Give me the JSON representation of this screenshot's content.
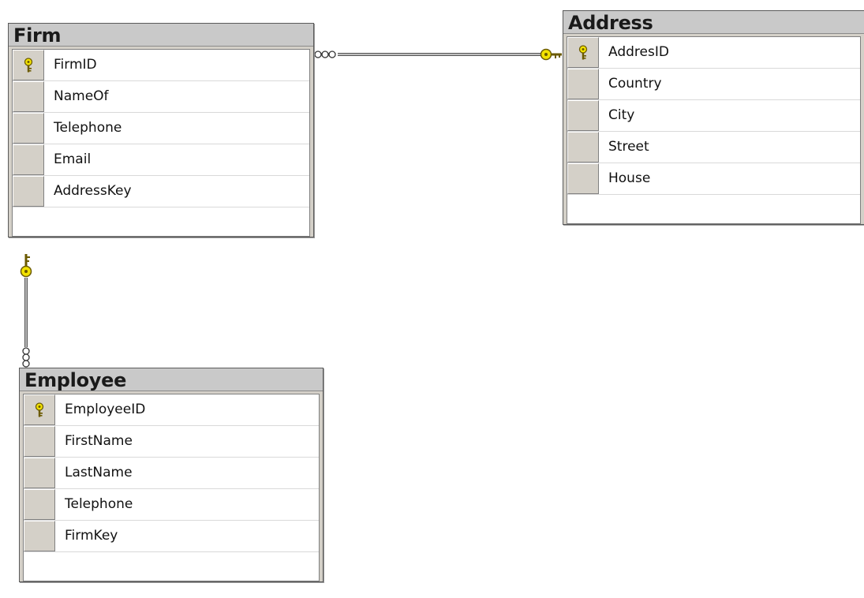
{
  "tables": {
    "firm": {
      "title": "Firm",
      "columns": [
        {
          "name": "FirmID",
          "primary_key": true
        },
        {
          "name": "NameOf",
          "primary_key": false
        },
        {
          "name": "Telephone",
          "primary_key": false
        },
        {
          "name": "Email",
          "primary_key": false
        },
        {
          "name": "AddressKey",
          "primary_key": false
        }
      ]
    },
    "address": {
      "title": "Address",
      "columns": [
        {
          "name": "AddresID",
          "primary_key": true
        },
        {
          "name": "Country",
          "primary_key": false
        },
        {
          "name": "City",
          "primary_key": false
        },
        {
          "name": "Street",
          "primary_key": false
        },
        {
          "name": "House",
          "primary_key": false
        }
      ]
    },
    "employee": {
      "title": "Employee",
      "columns": [
        {
          "name": "EmployeeID",
          "primary_key": true
        },
        {
          "name": "FirstName",
          "primary_key": false
        },
        {
          "name": "LastName",
          "primary_key": false
        },
        {
          "name": "Telephone",
          "primary_key": false
        },
        {
          "name": "FirmKey",
          "primary_key": false
        }
      ]
    }
  },
  "relationships": [
    {
      "from": "Firm",
      "to": "Address",
      "from_end": "many",
      "to_end": "one"
    },
    {
      "from": "Employee",
      "to": "Firm",
      "from_end": "many",
      "to_end": "one"
    }
  ],
  "colors": {
    "key": "#f2e200",
    "key_outline": "#6b5a00",
    "connector": "#555555"
  }
}
